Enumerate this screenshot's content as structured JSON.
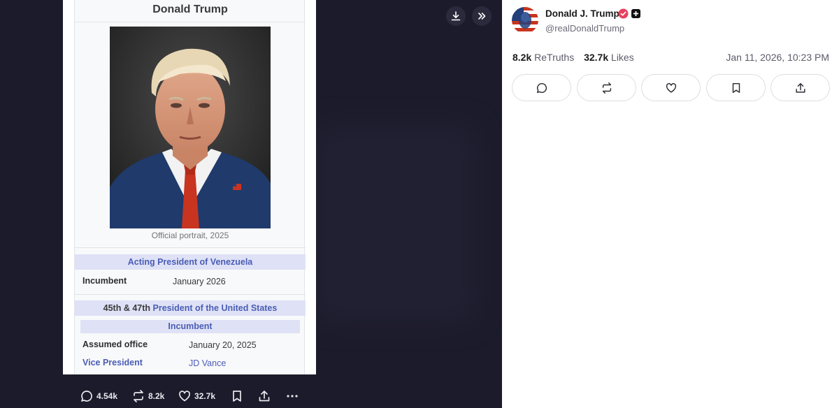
{
  "viewer": {
    "top_actions": {
      "download_icon": "download-icon",
      "expand_icon": "double-chevron-right-icon"
    },
    "wiki_card": {
      "title": "Donald Trump",
      "caption": "Official portrait, 2025",
      "section1": {
        "label": "Acting President of Venezuela"
      },
      "row1": {
        "key": "Incumbent",
        "value": "January 2026"
      },
      "section2": {
        "prefix": "45th & 47th",
        "link": "President of the United States"
      },
      "subband": "Incumbent",
      "row2": {
        "key": "Assumed office",
        "value": "January 20, 2025"
      },
      "row3": {
        "key": "Vice President",
        "value": "JD Vance"
      }
    },
    "bottom_bar": {
      "replies": "4.54k",
      "retruths": "8.2k",
      "likes": "32.7k"
    }
  },
  "post": {
    "author_name": "Donald J. Trump",
    "author_handle": "@realDonaldTrump",
    "retruths_count": "8.2k",
    "retruths_label": "ReTruths",
    "likes_count": "32.7k",
    "likes_label": "Likes",
    "timestamp": "Jan 11, 2026, 10:23 PM",
    "actions": [
      "reply-icon",
      "retruth-icon",
      "heart-icon",
      "bookmark-icon",
      "share-icon"
    ]
  },
  "colors": {
    "viewer_bg": "#1c1b2b",
    "wiki_band": "#dfe2f6",
    "wiki_link": "#4a5db5",
    "verified": "#e8405e"
  }
}
